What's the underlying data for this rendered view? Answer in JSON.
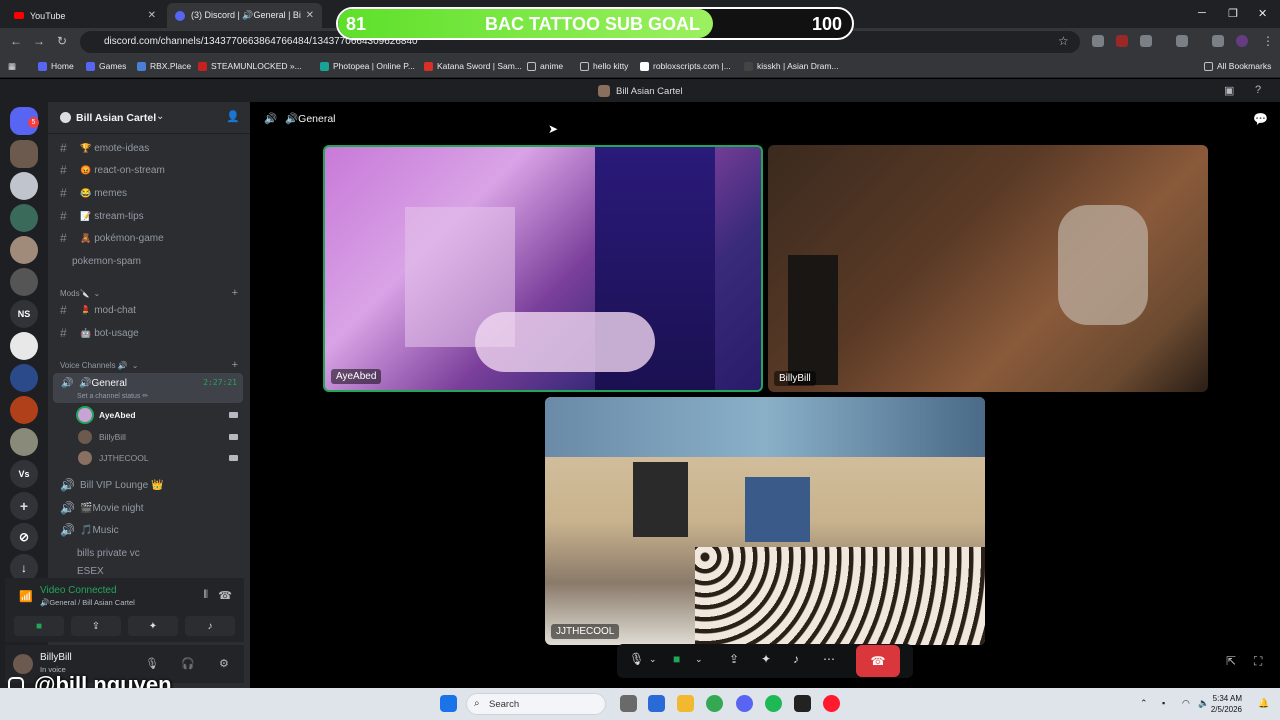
{
  "browser": {
    "tabs": [
      {
        "title": "YouTube"
      },
      {
        "title": "(3) Discord | 🔊General | Bi"
      }
    ],
    "url": "discord.com/channels/1343770663864766484/1343770664309626840",
    "bookmarks": [
      "Home",
      "Games",
      "RBX.Place",
      "STEAMUNLOCKED »...",
      "Photopea | Online P...",
      "Katana Sword | Sam...",
      "anime",
      "hello kitty",
      "robloxscripts.com |...",
      "kisskh | Asian Dram..."
    ],
    "all_bookmarks": "All Bookmarks"
  },
  "overlay": {
    "start": "81",
    "label": "BAC TATTOO SUB GOAL",
    "end": "100",
    "progress_fraction": 0.73,
    "fill_color": "#5de02a"
  },
  "window_title": "Bill Asian Cartel",
  "rail": {
    "badge": "5",
    "items": [
      "NS",
      "Vs"
    ]
  },
  "server": {
    "name": "Bill Asian Cartel",
    "channels": [
      {
        "emoji": "🏆",
        "name": "emote-ideas"
      },
      {
        "emoji": "😡",
        "name": "react-on-stream"
      },
      {
        "emoji": "😂",
        "name": "memes"
      },
      {
        "emoji": "📝",
        "name": "stream-tips"
      },
      {
        "emoji": "🧸",
        "name": "pokémon-game"
      },
      {
        "emoji": "",
        "name": "pokemon-spam"
      }
    ],
    "mods_category": "Mods🔪",
    "mod_channels": [
      {
        "emoji": "💄",
        "name": "mod-chat"
      },
      {
        "emoji": "🤖",
        "name": "bot-usage"
      }
    ],
    "voice_category": "Voice Channels 🔊",
    "active_voice": {
      "name": "🔊General",
      "time": "2:27:21",
      "status": "Set a channel status ✏"
    },
    "voice_users": [
      "AyeAbed",
      "BillyBill",
      "JJTHECOOL"
    ],
    "other_voice": [
      "Bill VIP Lounge 👑",
      "🎬Movie night",
      "🎵Music",
      "bills private vc",
      "ESEX"
    ]
  },
  "voice_panel": {
    "connected": "Video Connected",
    "location": "🔊General / Bill Asian Cartel"
  },
  "user": {
    "name": "BillyBill",
    "status": "In voice"
  },
  "watermark": "@bill.nguyen",
  "stage": {
    "channel": "🔊General",
    "tiles": [
      "AyeAbed",
      "BillyBill",
      "JJTHECOOL"
    ]
  },
  "taskbar": {
    "search": "Search",
    "time": "5:34 AM",
    "date": "2/5/2026"
  },
  "colors": {
    "accent": "#5865f2",
    "online": "#23a55a",
    "hangup": "#da373c"
  }
}
